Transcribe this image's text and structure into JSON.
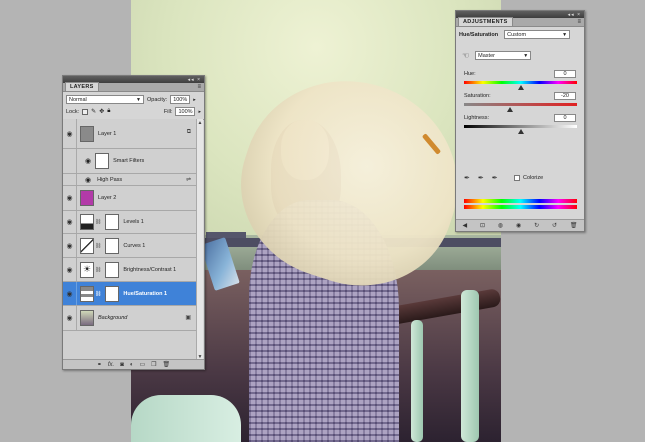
{
  "layers_panel": {
    "tab": "LAYERS",
    "blend_mode": "Normal",
    "opacity_label": "Opacity:",
    "opacity_value": "100%",
    "lock_label": "Lock:",
    "fill_label": "Fill:",
    "fill_value": "100%",
    "layers": [
      {
        "name": "Layer 1"
      },
      {
        "name": "Smart Filters"
      },
      {
        "name": "High Pass"
      },
      {
        "name": "Layer 2"
      },
      {
        "name": "Levels 1"
      },
      {
        "name": "Curves 1"
      },
      {
        "name": "Brightness/Contrast 1"
      },
      {
        "name": "Hue/Saturation 1"
      },
      {
        "name": "Background"
      }
    ],
    "selected_layer": "Hue/Saturation 1",
    "footer_fx": "fx."
  },
  "adjustments_panel": {
    "tab": "ADJUSTMENTS",
    "title": "Hue/Saturation",
    "preset": "Custom",
    "channel": "Master",
    "hue": {
      "label": "Hue:",
      "value": "0"
    },
    "saturation": {
      "label": "Saturation:",
      "value": "-20"
    },
    "lightness": {
      "label": "Lightness:",
      "value": "0"
    },
    "colorize_label": "Colorize"
  },
  "colors": {
    "selected_row": "#3f82d8",
    "layer2_swatch": "#b23aa8",
    "panel_bg": "#d6d6d6"
  }
}
